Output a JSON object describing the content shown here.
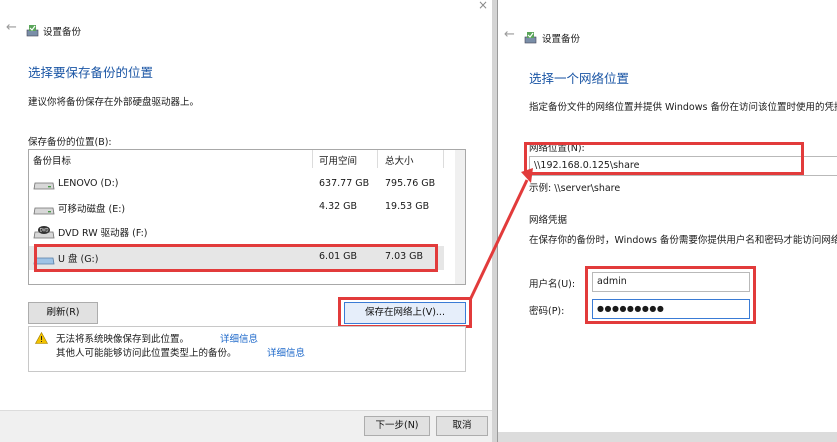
{
  "left": {
    "window_title": "设置备份",
    "heading": "选择要保存备份的位置",
    "recommend_text": "建议你将备份保存在外部硬盘驱动器上。",
    "location_label": "保存备份的位置(B):",
    "columns": {
      "target": "备份目标",
      "free": "可用空间",
      "total": "总大小"
    },
    "drives": [
      {
        "name": "LENOVO (D:)",
        "free": "637.77 GB",
        "total": "795.76 GB",
        "icon": "hard-drive-icon"
      },
      {
        "name": "可移动磁盘 (E:)",
        "free": "4.32 GB",
        "total": "19.53 GB",
        "icon": "removable-disk-icon"
      },
      {
        "name": "DVD RW 驱动器 (F:)",
        "free": "",
        "total": "",
        "icon": "dvd-drive-icon"
      },
      {
        "name": "U 盘 (G:)",
        "free": "6.01 GB",
        "total": "7.03 GB",
        "icon": "usb-drive-icon"
      }
    ],
    "refresh_button": "刷新(R)",
    "save_network_button": "保存在网络上(V)...",
    "warning_line1": "无法将系统映像保存到此位置。",
    "warning_link1": "详细信息",
    "warning_line2": "其他人可能能够访问此位置类型上的备份。",
    "warning_link2": "详细信息",
    "next_button": "下一步(N)",
    "cancel_button": "取消"
  },
  "right": {
    "window_title": "设置备份",
    "heading": "选择一个网络位置",
    "description": "指定备份文件的网络位置并提供 Windows 备份在访问该位置时使用的凭据",
    "network_label": "网络位置(N):",
    "network_value": "\\\\192.168.0.125\\share",
    "example_text": "示例: \\\\server\\share",
    "credentials_title": "网络凭据",
    "credentials_desc": "在保存你的备份时，Windows 备份需要你提供用户名和密码才能访问网络",
    "username_label": "用户名(U):",
    "username_value": "admin",
    "password_label": "密码(P):",
    "password_value": "●●●●●●●●●"
  },
  "colors": {
    "accent": "#1b56a5",
    "highlight": "#e23b3b",
    "link": "#1a66c9"
  }
}
